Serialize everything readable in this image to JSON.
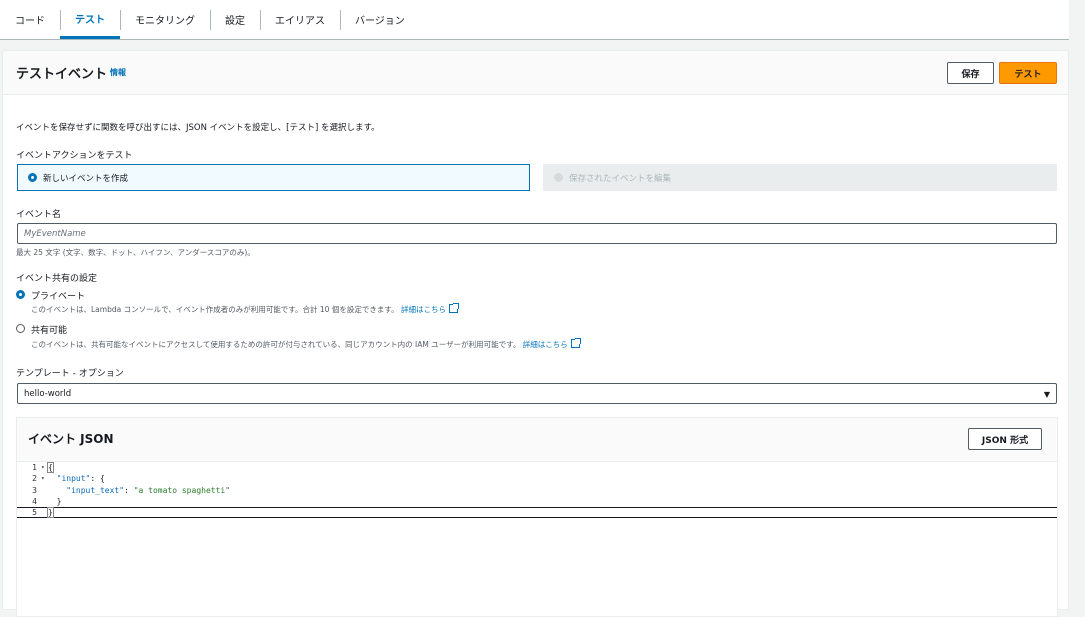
{
  "tabs": [
    "コード",
    "テスト",
    "モニタリング",
    "設定",
    "エイリアス",
    "バージョン"
  ],
  "active_tab": "テスト",
  "header": {
    "title": "テストイベント",
    "info": "情報",
    "save_label": "保存",
    "test_label": "テスト"
  },
  "description": "イベントを保存せずに関数を呼び出すには、JSON イベントを設定し、[テスト] を選択します。",
  "event_action": {
    "label": "イベントアクションをテスト",
    "option_new": "新しいイベントを作成",
    "option_edit": "保存されたイベントを編集"
  },
  "event_name": {
    "label": "イベント名",
    "placeholder": "MyEventName",
    "hint": "最大 25 文字 (文字、数字、ドット、ハイフン、アンダースコアのみ)。"
  },
  "sharing": {
    "label": "イベント共有の設定",
    "private_label": "プライベート",
    "private_desc": "このイベントは、Lambda コンソールで、イベント作成者のみが利用可能です。合計 10 個を設定できます。",
    "shareable_label": "共有可能",
    "shareable_desc": "このイベントは、共有可能なイベントにアクセスして使用するための許可が付与されている、同じアカウント内の IAM ユーザーが利用可能です。",
    "learn_more": "詳細はこちら"
  },
  "template": {
    "label": "テンプレート - オプション",
    "value": "hello-world"
  },
  "json_editor": {
    "title": "イベント JSON",
    "format_label": "JSON 形式",
    "lines": [
      {
        "n": "1",
        "text": "{"
      },
      {
        "n": "2",
        "key": "\"input\"",
        "rest": ": {"
      },
      {
        "n": "3",
        "key": "\"input_text\"",
        "rest": ": ",
        "val": "\"a tomato spaghetti\""
      },
      {
        "n": "4",
        "text": "  }"
      },
      {
        "n": "5",
        "text": "}"
      }
    ]
  }
}
